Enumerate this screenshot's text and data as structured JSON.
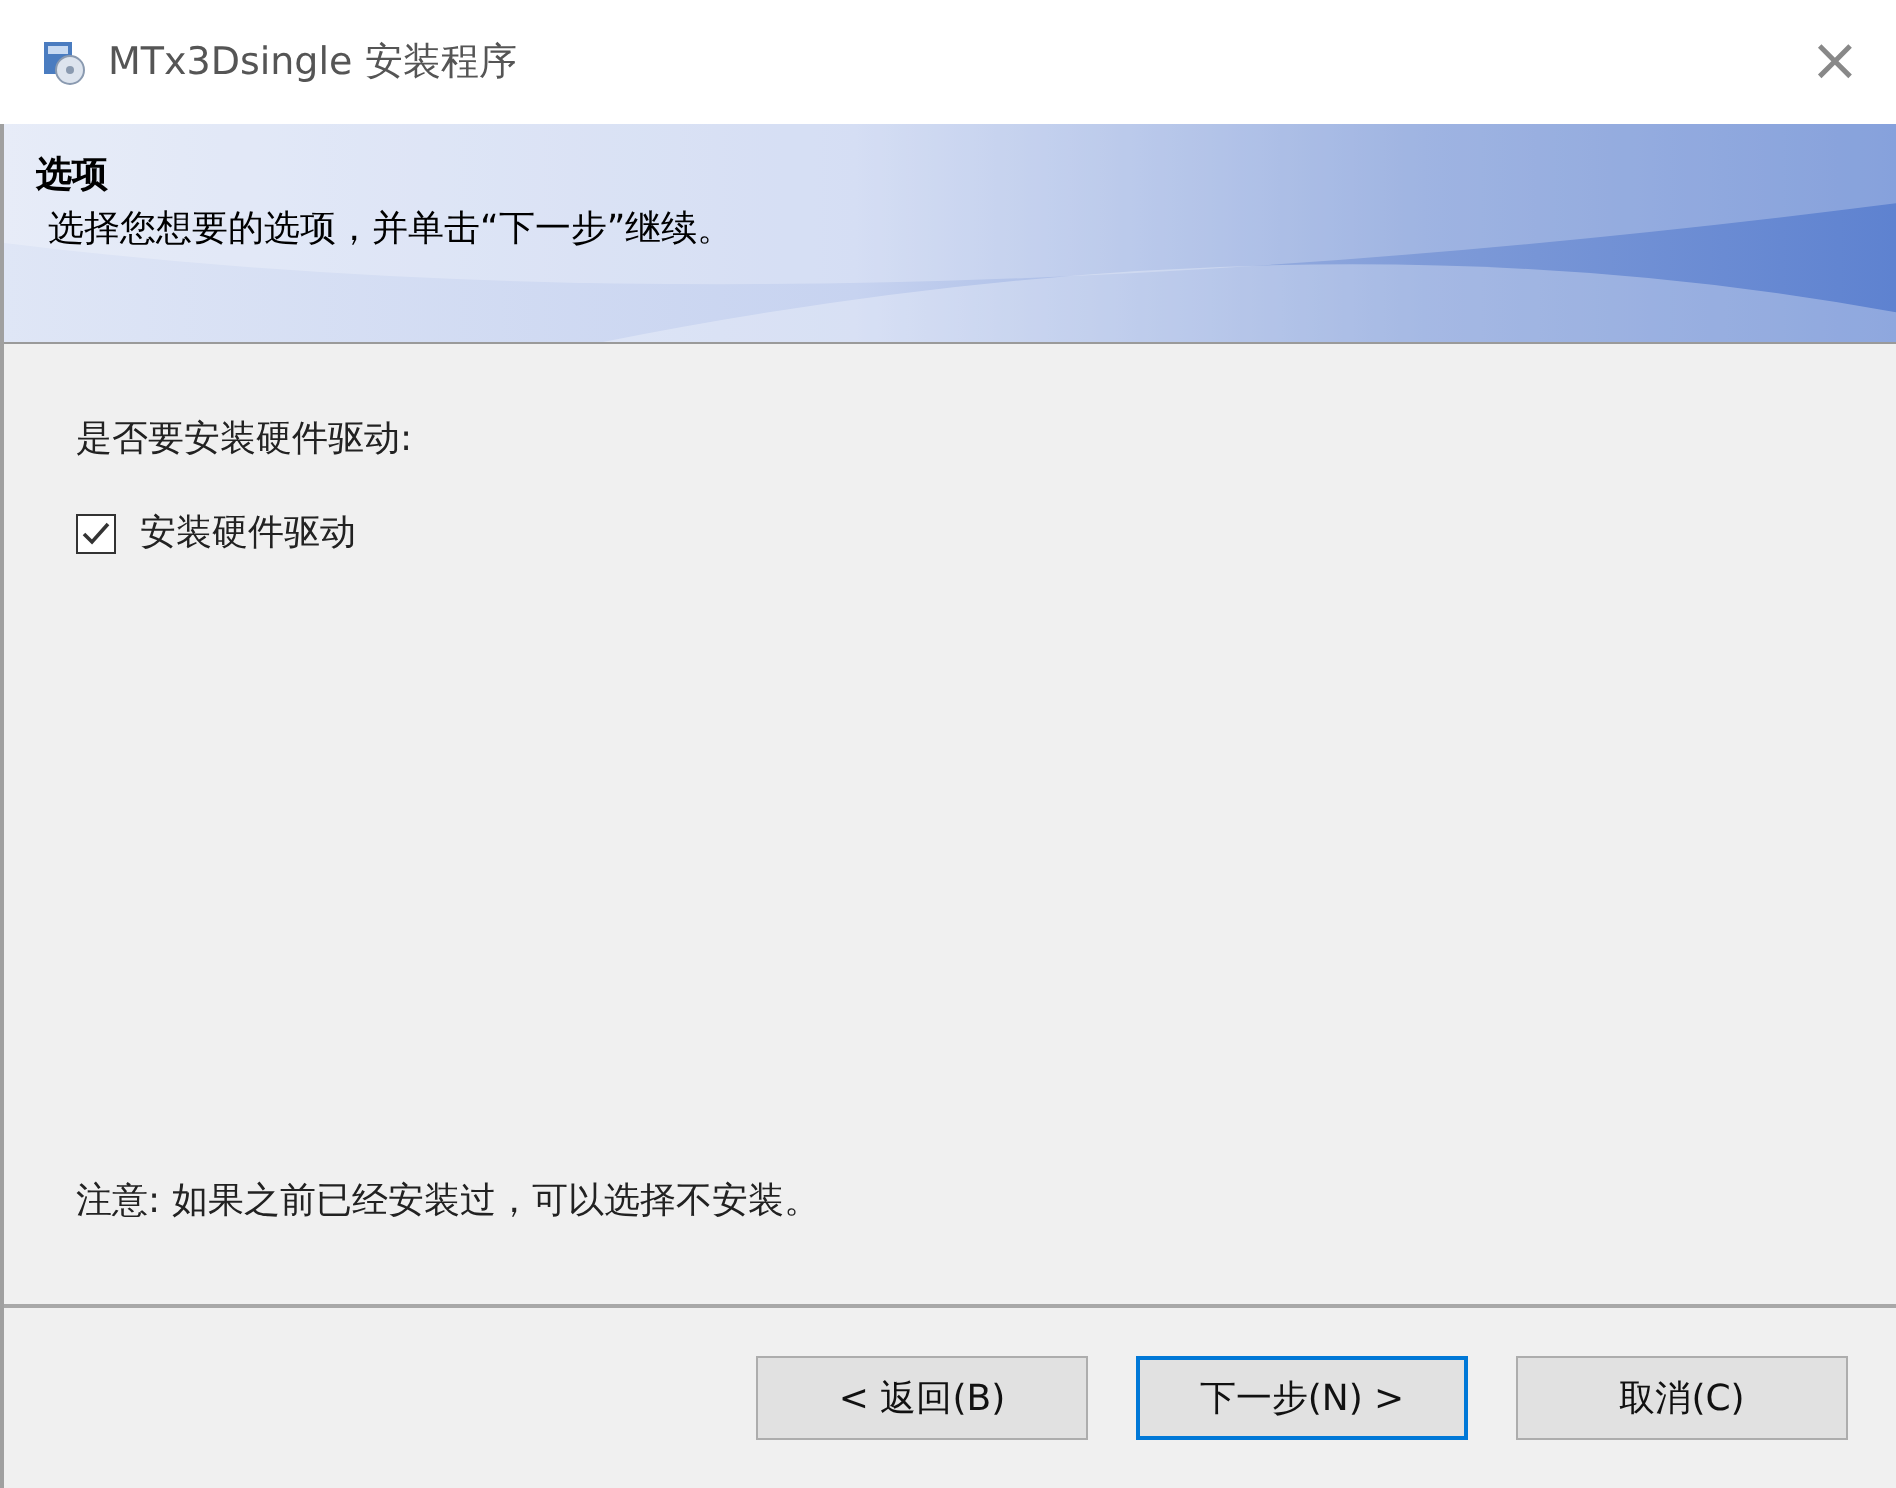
{
  "window": {
    "title": "MTx3Dsingle 安装程序",
    "close": "×"
  },
  "header": {
    "title": "选项",
    "subtitle": "选择您想要的选项，并单击“下一步”继续。"
  },
  "content": {
    "question": "是否要安装硬件驱动:",
    "options": [
      {
        "label": "安装硬件驱动",
        "checked": true
      }
    ],
    "note": "注意: 如果之前已经安装过，可以选择不安装。"
  },
  "buttons": [
    {
      "label": "< 返回(B)",
      "default": false
    },
    {
      "label": "下一步(N) >",
      "default": true
    },
    {
      "label": "取消(C)",
      "default": false
    }
  ]
}
